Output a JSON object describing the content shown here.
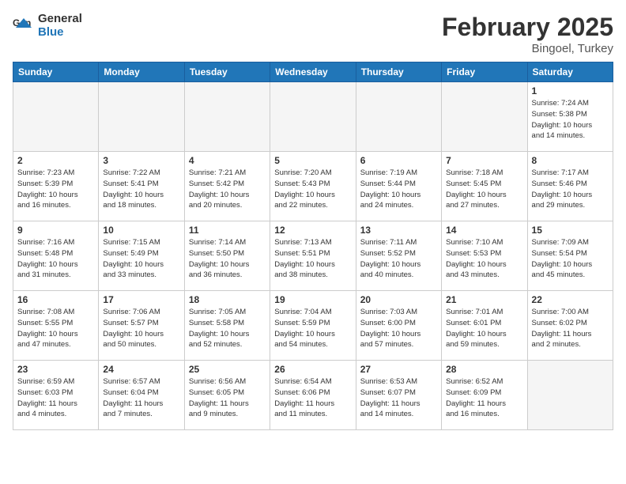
{
  "header": {
    "logo_line1": "General",
    "logo_line2": "Blue",
    "title": "February 2025",
    "subtitle": "Bingoel, Turkey"
  },
  "weekdays": [
    "Sunday",
    "Monday",
    "Tuesday",
    "Wednesday",
    "Thursday",
    "Friday",
    "Saturday"
  ],
  "weeks": [
    [
      {
        "day": "",
        "info": ""
      },
      {
        "day": "",
        "info": ""
      },
      {
        "day": "",
        "info": ""
      },
      {
        "day": "",
        "info": ""
      },
      {
        "day": "",
        "info": ""
      },
      {
        "day": "",
        "info": ""
      },
      {
        "day": "1",
        "info": "Sunrise: 7:24 AM\nSunset: 5:38 PM\nDaylight: 10 hours\nand 14 minutes."
      }
    ],
    [
      {
        "day": "2",
        "info": "Sunrise: 7:23 AM\nSunset: 5:39 PM\nDaylight: 10 hours\nand 16 minutes."
      },
      {
        "day": "3",
        "info": "Sunrise: 7:22 AM\nSunset: 5:41 PM\nDaylight: 10 hours\nand 18 minutes."
      },
      {
        "day": "4",
        "info": "Sunrise: 7:21 AM\nSunset: 5:42 PM\nDaylight: 10 hours\nand 20 minutes."
      },
      {
        "day": "5",
        "info": "Sunrise: 7:20 AM\nSunset: 5:43 PM\nDaylight: 10 hours\nand 22 minutes."
      },
      {
        "day": "6",
        "info": "Sunrise: 7:19 AM\nSunset: 5:44 PM\nDaylight: 10 hours\nand 24 minutes."
      },
      {
        "day": "7",
        "info": "Sunrise: 7:18 AM\nSunset: 5:45 PM\nDaylight: 10 hours\nand 27 minutes."
      },
      {
        "day": "8",
        "info": "Sunrise: 7:17 AM\nSunset: 5:46 PM\nDaylight: 10 hours\nand 29 minutes."
      }
    ],
    [
      {
        "day": "9",
        "info": "Sunrise: 7:16 AM\nSunset: 5:48 PM\nDaylight: 10 hours\nand 31 minutes."
      },
      {
        "day": "10",
        "info": "Sunrise: 7:15 AM\nSunset: 5:49 PM\nDaylight: 10 hours\nand 33 minutes."
      },
      {
        "day": "11",
        "info": "Sunrise: 7:14 AM\nSunset: 5:50 PM\nDaylight: 10 hours\nand 36 minutes."
      },
      {
        "day": "12",
        "info": "Sunrise: 7:13 AM\nSunset: 5:51 PM\nDaylight: 10 hours\nand 38 minutes."
      },
      {
        "day": "13",
        "info": "Sunrise: 7:11 AM\nSunset: 5:52 PM\nDaylight: 10 hours\nand 40 minutes."
      },
      {
        "day": "14",
        "info": "Sunrise: 7:10 AM\nSunset: 5:53 PM\nDaylight: 10 hours\nand 43 minutes."
      },
      {
        "day": "15",
        "info": "Sunrise: 7:09 AM\nSunset: 5:54 PM\nDaylight: 10 hours\nand 45 minutes."
      }
    ],
    [
      {
        "day": "16",
        "info": "Sunrise: 7:08 AM\nSunset: 5:55 PM\nDaylight: 10 hours\nand 47 minutes."
      },
      {
        "day": "17",
        "info": "Sunrise: 7:06 AM\nSunset: 5:57 PM\nDaylight: 10 hours\nand 50 minutes."
      },
      {
        "day": "18",
        "info": "Sunrise: 7:05 AM\nSunset: 5:58 PM\nDaylight: 10 hours\nand 52 minutes."
      },
      {
        "day": "19",
        "info": "Sunrise: 7:04 AM\nSunset: 5:59 PM\nDaylight: 10 hours\nand 54 minutes."
      },
      {
        "day": "20",
        "info": "Sunrise: 7:03 AM\nSunset: 6:00 PM\nDaylight: 10 hours\nand 57 minutes."
      },
      {
        "day": "21",
        "info": "Sunrise: 7:01 AM\nSunset: 6:01 PM\nDaylight: 10 hours\nand 59 minutes."
      },
      {
        "day": "22",
        "info": "Sunrise: 7:00 AM\nSunset: 6:02 PM\nDaylight: 11 hours\nand 2 minutes."
      }
    ],
    [
      {
        "day": "23",
        "info": "Sunrise: 6:59 AM\nSunset: 6:03 PM\nDaylight: 11 hours\nand 4 minutes."
      },
      {
        "day": "24",
        "info": "Sunrise: 6:57 AM\nSunset: 6:04 PM\nDaylight: 11 hours\nand 7 minutes."
      },
      {
        "day": "25",
        "info": "Sunrise: 6:56 AM\nSunset: 6:05 PM\nDaylight: 11 hours\nand 9 minutes."
      },
      {
        "day": "26",
        "info": "Sunrise: 6:54 AM\nSunset: 6:06 PM\nDaylight: 11 hours\nand 11 minutes."
      },
      {
        "day": "27",
        "info": "Sunrise: 6:53 AM\nSunset: 6:07 PM\nDaylight: 11 hours\nand 14 minutes."
      },
      {
        "day": "28",
        "info": "Sunrise: 6:52 AM\nSunset: 6:09 PM\nDaylight: 11 hours\nand 16 minutes."
      },
      {
        "day": "",
        "info": ""
      }
    ]
  ]
}
